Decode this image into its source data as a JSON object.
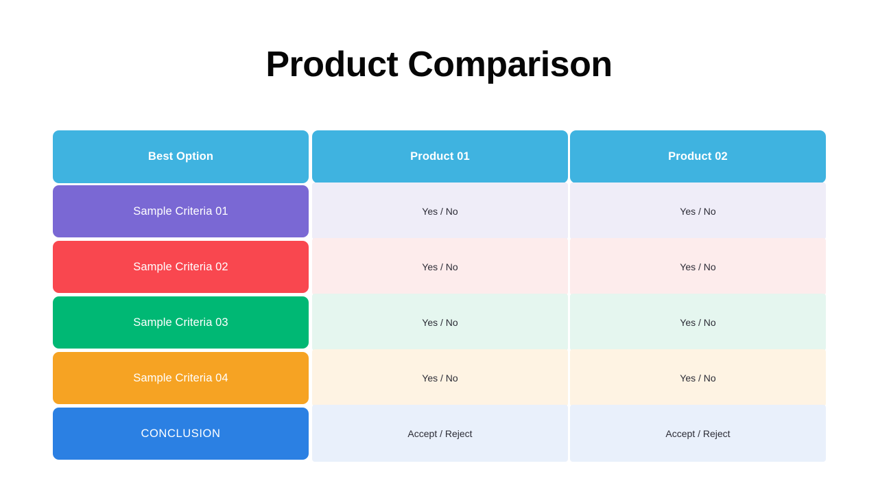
{
  "slide": {
    "title": "Product Comparison",
    "background_color": "#FFFFFF",
    "title_color": "#060606"
  },
  "table": {
    "columns": [
      {
        "key": "criteria",
        "label": "Best Option"
      },
      {
        "key": "product_01",
        "label": "Product 01"
      },
      {
        "key": "product_02",
        "label": "Product 02"
      }
    ],
    "header": {
      "background_color": "#3FB3E0",
      "text_color": "#FFFFFF"
    },
    "rows": [
      {
        "label": "Sample Criteria 01",
        "label_color": "#7A68D4",
        "value_bg": "#EFEDF8",
        "product_01": "Yes / No",
        "product_02": "Yes / No"
      },
      {
        "label": "Sample Criteria 02",
        "label_color": "#F9474F",
        "value_bg": "#FDECEC",
        "product_01": "Yes / No",
        "product_02": "Yes / No"
      },
      {
        "label": "Sample Criteria 03",
        "label_color": "#00B874",
        "value_bg": "#E5F6EF",
        "product_01": "Yes / No",
        "product_02": "Yes / No"
      },
      {
        "label": "Sample Criteria 04",
        "label_color": "#F6A323",
        "value_bg": "#FEF3E3",
        "product_01": "Yes / No",
        "product_02": "Yes / No"
      },
      {
        "label": "CONCLUSION",
        "label_color": "#2B80E3",
        "value_bg": "#E9F0FB",
        "product_01": "Accept / Reject",
        "product_02": "Accept / Reject"
      }
    ]
  }
}
